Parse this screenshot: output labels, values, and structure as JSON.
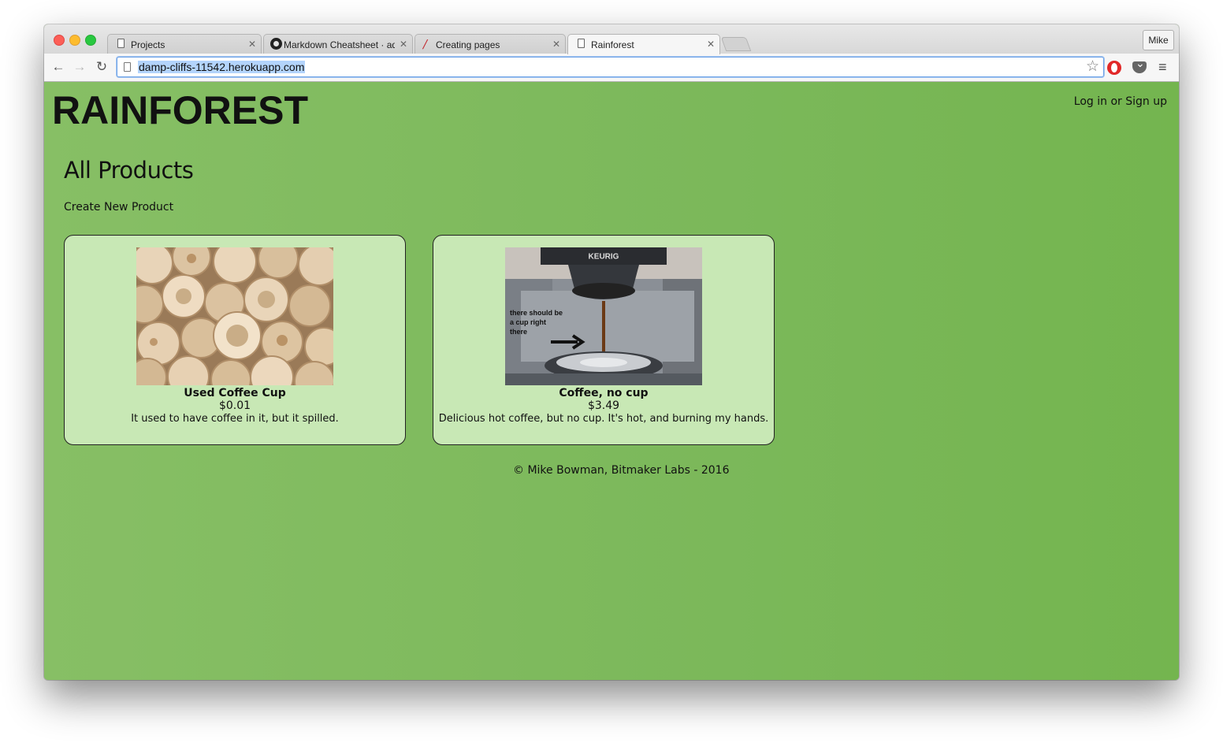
{
  "browser": {
    "tabs": [
      {
        "title": "Projects",
        "icon": "document-icon"
      },
      {
        "title": "Markdown Cheatsheet · adam-p/markdown-here Wiki",
        "icon": "github-icon"
      },
      {
        "title": "Creating pages",
        "icon": "slash-icon"
      },
      {
        "title": "Rainforest",
        "icon": "document-icon"
      }
    ],
    "profile": "Mike",
    "url": "damp-cliffs-11542.herokuapp.com"
  },
  "site": {
    "logo": "RAINFOREST",
    "login": "Log in",
    "or": "or",
    "signup": "Sign up"
  },
  "main": {
    "heading": "All Products",
    "create_link": "Create New Product"
  },
  "products": [
    {
      "name": "Used Coffee Cup",
      "price": "$0.01",
      "description": "It used to have coffee in it, but it spilled."
    },
    {
      "name": "Coffee, no cup",
      "price": "$3.49",
      "description": "Delicious hot coffee, but no cup. It's hot, and burning my hands.",
      "image_text_brand": "KEURIG",
      "image_text_note": "there should be a cup right there"
    }
  ],
  "footer": "© Mike Bowman, Bitmaker Labs - 2016",
  "colors": {
    "page_bg": "#7cba5a",
    "card_bg": "#c8e8b5"
  }
}
